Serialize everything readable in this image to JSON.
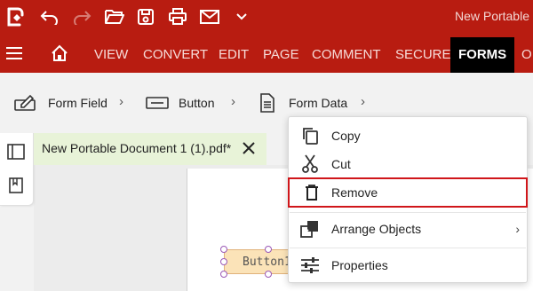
{
  "app_title": "New Portable",
  "menu_tabs": [
    "VIEW",
    "CONVERT",
    "EDIT",
    "PAGE",
    "COMMENT",
    "SECURE",
    "FORMS",
    "O"
  ],
  "active_tab": "FORMS",
  "ribbon": {
    "form_field_label": "Form Field",
    "button_label": "Button",
    "form_data_label": "Form Data"
  },
  "document_tab": {
    "title": "New Portable Document 1 (1).pdf*"
  },
  "form_button": {
    "label": "Button1"
  },
  "context_menu": {
    "items": [
      {
        "label": "Copy",
        "icon": "copy-icon"
      },
      {
        "label": "Cut",
        "icon": "scissors-icon"
      },
      {
        "label": "Remove",
        "icon": "trash-icon"
      },
      {
        "label": "Arrange Objects",
        "icon": "arrange-icon"
      },
      {
        "label": "Properties",
        "icon": "sliders-icon"
      }
    ]
  },
  "colors": {
    "brand": "#b81c11",
    "highlight": "#d0161a",
    "doc_tab_bg": "#e8f3d8"
  }
}
